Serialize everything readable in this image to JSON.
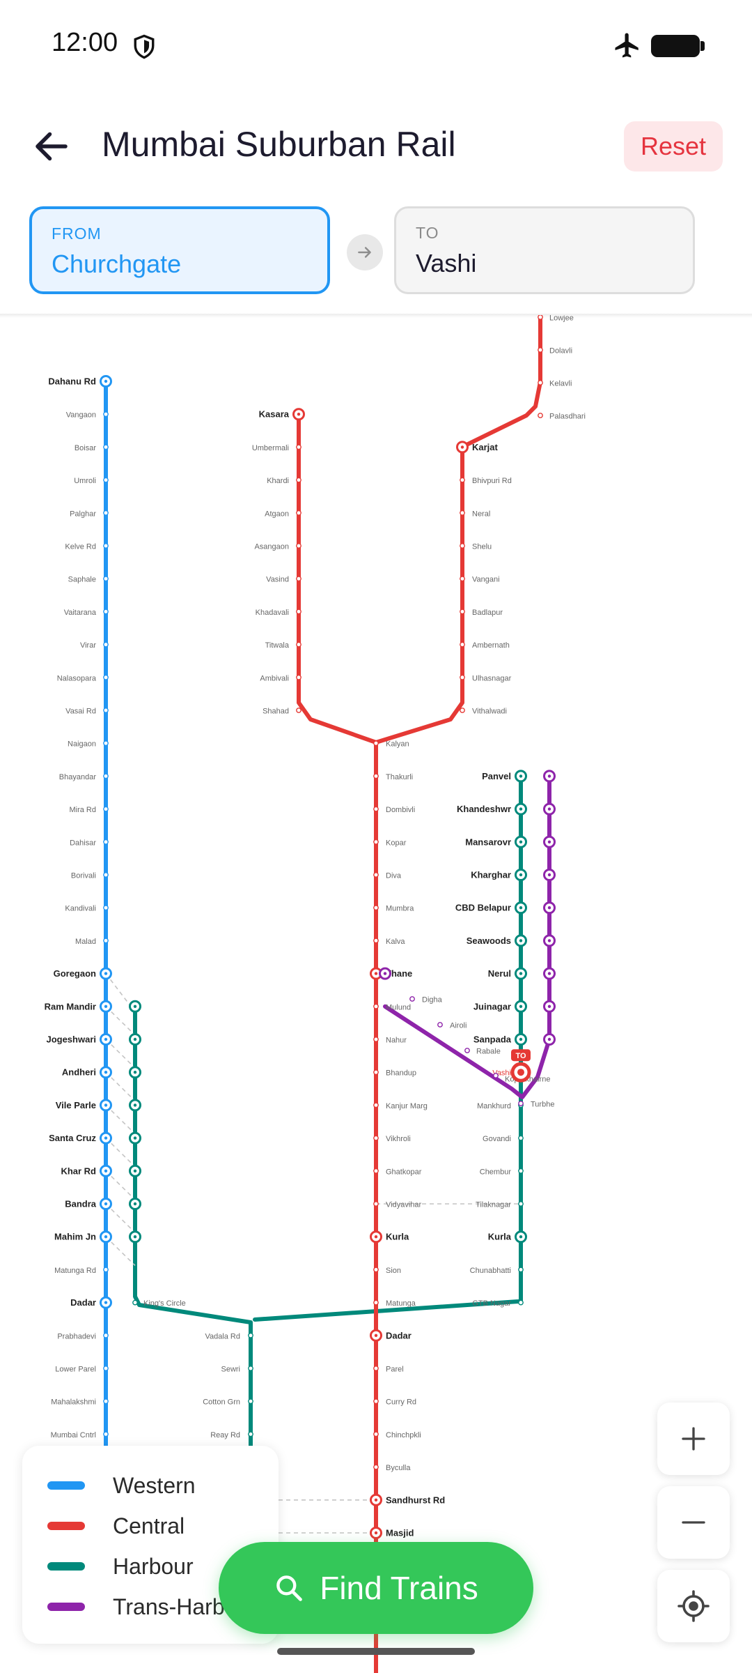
{
  "status": {
    "time": "12:00"
  },
  "header": {
    "title": "Mumbai Suburban Rail",
    "reset_label": "Reset"
  },
  "route": {
    "from_label": "FROM",
    "from_value": "Churchgate",
    "to_label": "TO",
    "to_value": "Vashi"
  },
  "colors": {
    "western": "#2196f3",
    "central": "#e53935",
    "harbour": "#00897b",
    "trans_harbour": "#8e24aa",
    "accent": "#34c759"
  },
  "map": {
    "western": {
      "stations": [
        "Dahanu Rd",
        "Vangaon",
        "Boisar",
        "Umroli",
        "Palghar",
        "Kelve Rd",
        "Saphale",
        "Vaitarana",
        "Virar",
        "Nalasopara",
        "Vasai Rd",
        "Naigaon",
        "Bhayandar",
        "Mira Rd",
        "Dahisar",
        "Borivali",
        "Kandivali",
        "Malad",
        "Goregaon",
        "Ram Mandir",
        "Jogeshwari",
        "Andheri",
        "Vile Parle",
        "Santa Cruz",
        "Khar Rd",
        "Bandra",
        "Mahim Jn",
        "Matunga Rd",
        "Dadar",
        "Prabhadevi",
        "Lower Parel",
        "Mahalakshmi",
        "Mumbai Cntrl"
      ],
      "major": [
        "Dahanu Rd",
        "Goregaon",
        "Ram Mandir",
        "Jogeshwari",
        "Andheri",
        "Vile Parle",
        "Santa Cruz",
        "Khar Rd",
        "Bandra",
        "Mahim Jn",
        "Dadar"
      ]
    },
    "harbour_west": {
      "stations": [
        "Ram Mandir",
        "Jogeshwari",
        "Andheri",
        "Vile Parle",
        "Santa Cruz",
        "Khar Rd",
        "Bandra",
        "Mahim Jn"
      ],
      "branch_labels": [
        "King's Circle",
        "Vadala Rd",
        "Sewri",
        "Cotton Grn",
        "Reay Rd"
      ]
    },
    "central_kasara": [
      "Kasara",
      "Umbermali",
      "Khardi",
      "Atgaon",
      "Asangaon",
      "Vasind",
      "Khadavali",
      "Titwala",
      "Ambivali",
      "Shahad"
    ],
    "central_karjat_north": [
      "Lowjee",
      "Dolavli",
      "Kelavli",
      "Palasdhari"
    ],
    "central_karjat": [
      "Karjat",
      "Bhivpuri Rd",
      "Neral",
      "Shelu",
      "Vangani",
      "Badlapur",
      "Ambernath",
      "Ulhasnagar",
      "Vithalwadi"
    ],
    "central_main": [
      "Kalyan",
      "Thakurli",
      "Dombivli",
      "Kopar",
      "Diva",
      "Mumbra",
      "Kalva",
      "Thane",
      "Mulund",
      "Nahur",
      "Bhandup",
      "Kanjur Marg",
      "Vikhroli",
      "Ghatkopar",
      "Vidyavihar",
      "Kurla",
      "Sion",
      "Matunga",
      "Dadar",
      "Parel",
      "Curry Rd",
      "Chinchpkli",
      "Byculla",
      "Sandhurst Rd",
      "Masjid"
    ],
    "central_major": [
      "Kasara",
      "Karjat",
      "Thane",
      "Kurla",
      "Dadar",
      "Sandhurst Rd",
      "Masjid"
    ],
    "harbour_east": [
      "Panvel",
      "Khandeshwr",
      "Mansarovr",
      "Kharghar",
      "CBD Belapur",
      "Seawoods",
      "Nerul",
      "Juinagar",
      "Sanpada",
      "Vashi",
      "Mankhurd",
      "Govandi",
      "Chembur",
      "Tilaknagar",
      "Kurla",
      "Chunabhatti",
      "GTB Nagar"
    ],
    "harbour_east_major": [
      "Panvel",
      "Khandeshwr",
      "Mansarovr",
      "Kharghar",
      "CBD Belapur",
      "Seawoods",
      "Nerul",
      "Juinagar",
      "Sanpada",
      "Kurla"
    ],
    "trans_harbour": [
      "Digha",
      "Airoli",
      "Rabale",
      "Koparkhairne",
      "Turbhe"
    ],
    "destination_marker": "TO",
    "destination_station": "Vashi"
  },
  "legend": [
    {
      "label": "Western",
      "color": "#2196f3"
    },
    {
      "label": "Central",
      "color": "#e53935"
    },
    {
      "label": "Harbour",
      "color": "#00897b"
    },
    {
      "label": "Trans-Harbour",
      "color": "#8e24aa"
    }
  ],
  "controls": {
    "zoom_in_icon": "plus-icon",
    "zoom_out_icon": "minus-icon",
    "locate_icon": "locate-icon"
  },
  "cta": {
    "label": "Find Trains",
    "icon": "search-icon"
  }
}
